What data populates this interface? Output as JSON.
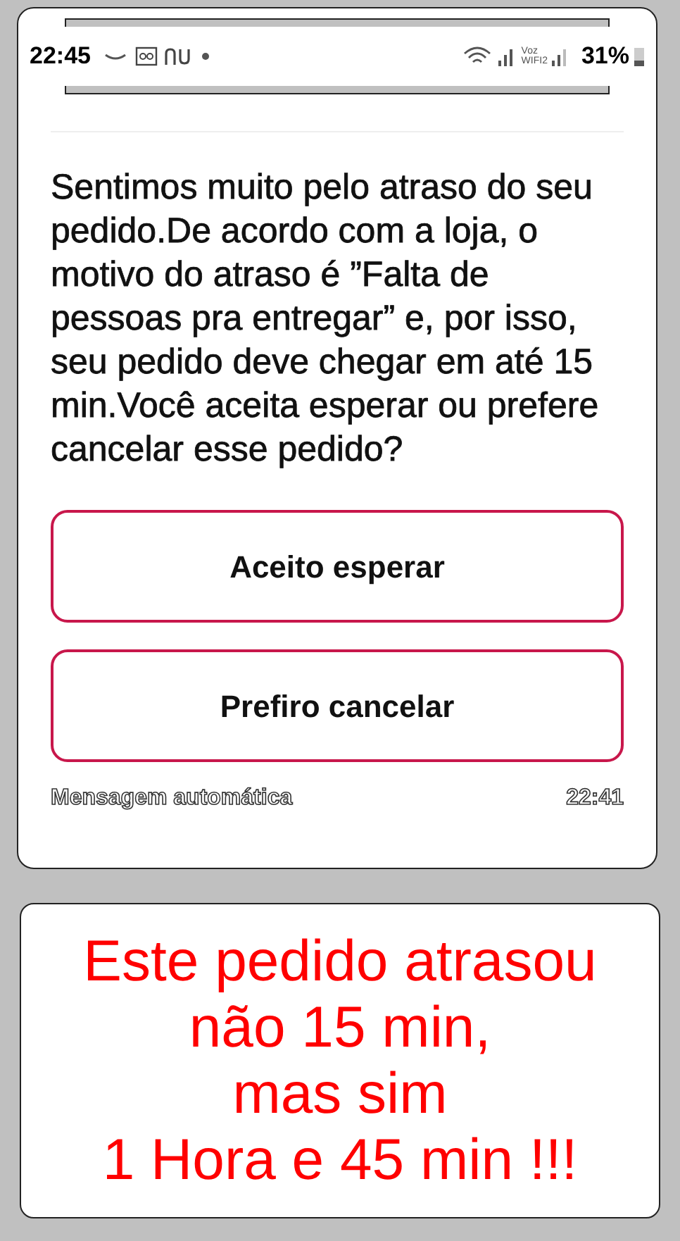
{
  "status_bar": {
    "time": "22:45",
    "voice_label": "Voz",
    "wifi_label": "WIFI2",
    "battery": "31%"
  },
  "message": {
    "text": "Sentimos muito pelo atraso do seu pedido.De acordo com a loja, o motivo do atraso é ”Falta de pessoas pra entregar” e, por isso, seu pedido deve chegar em até 15 min.Você aceita esperar ou prefere cancelar esse pedido?"
  },
  "buttons": [
    "Aceito esperar",
    "Prefiro cancelar"
  ],
  "footer": {
    "label": "Mensagem automática",
    "time": "22:41"
  },
  "caption": [
    "Este pedido atrasou",
    "não 15 min,",
    "mas sim",
    "1 Hora e 45 min !!!"
  ]
}
